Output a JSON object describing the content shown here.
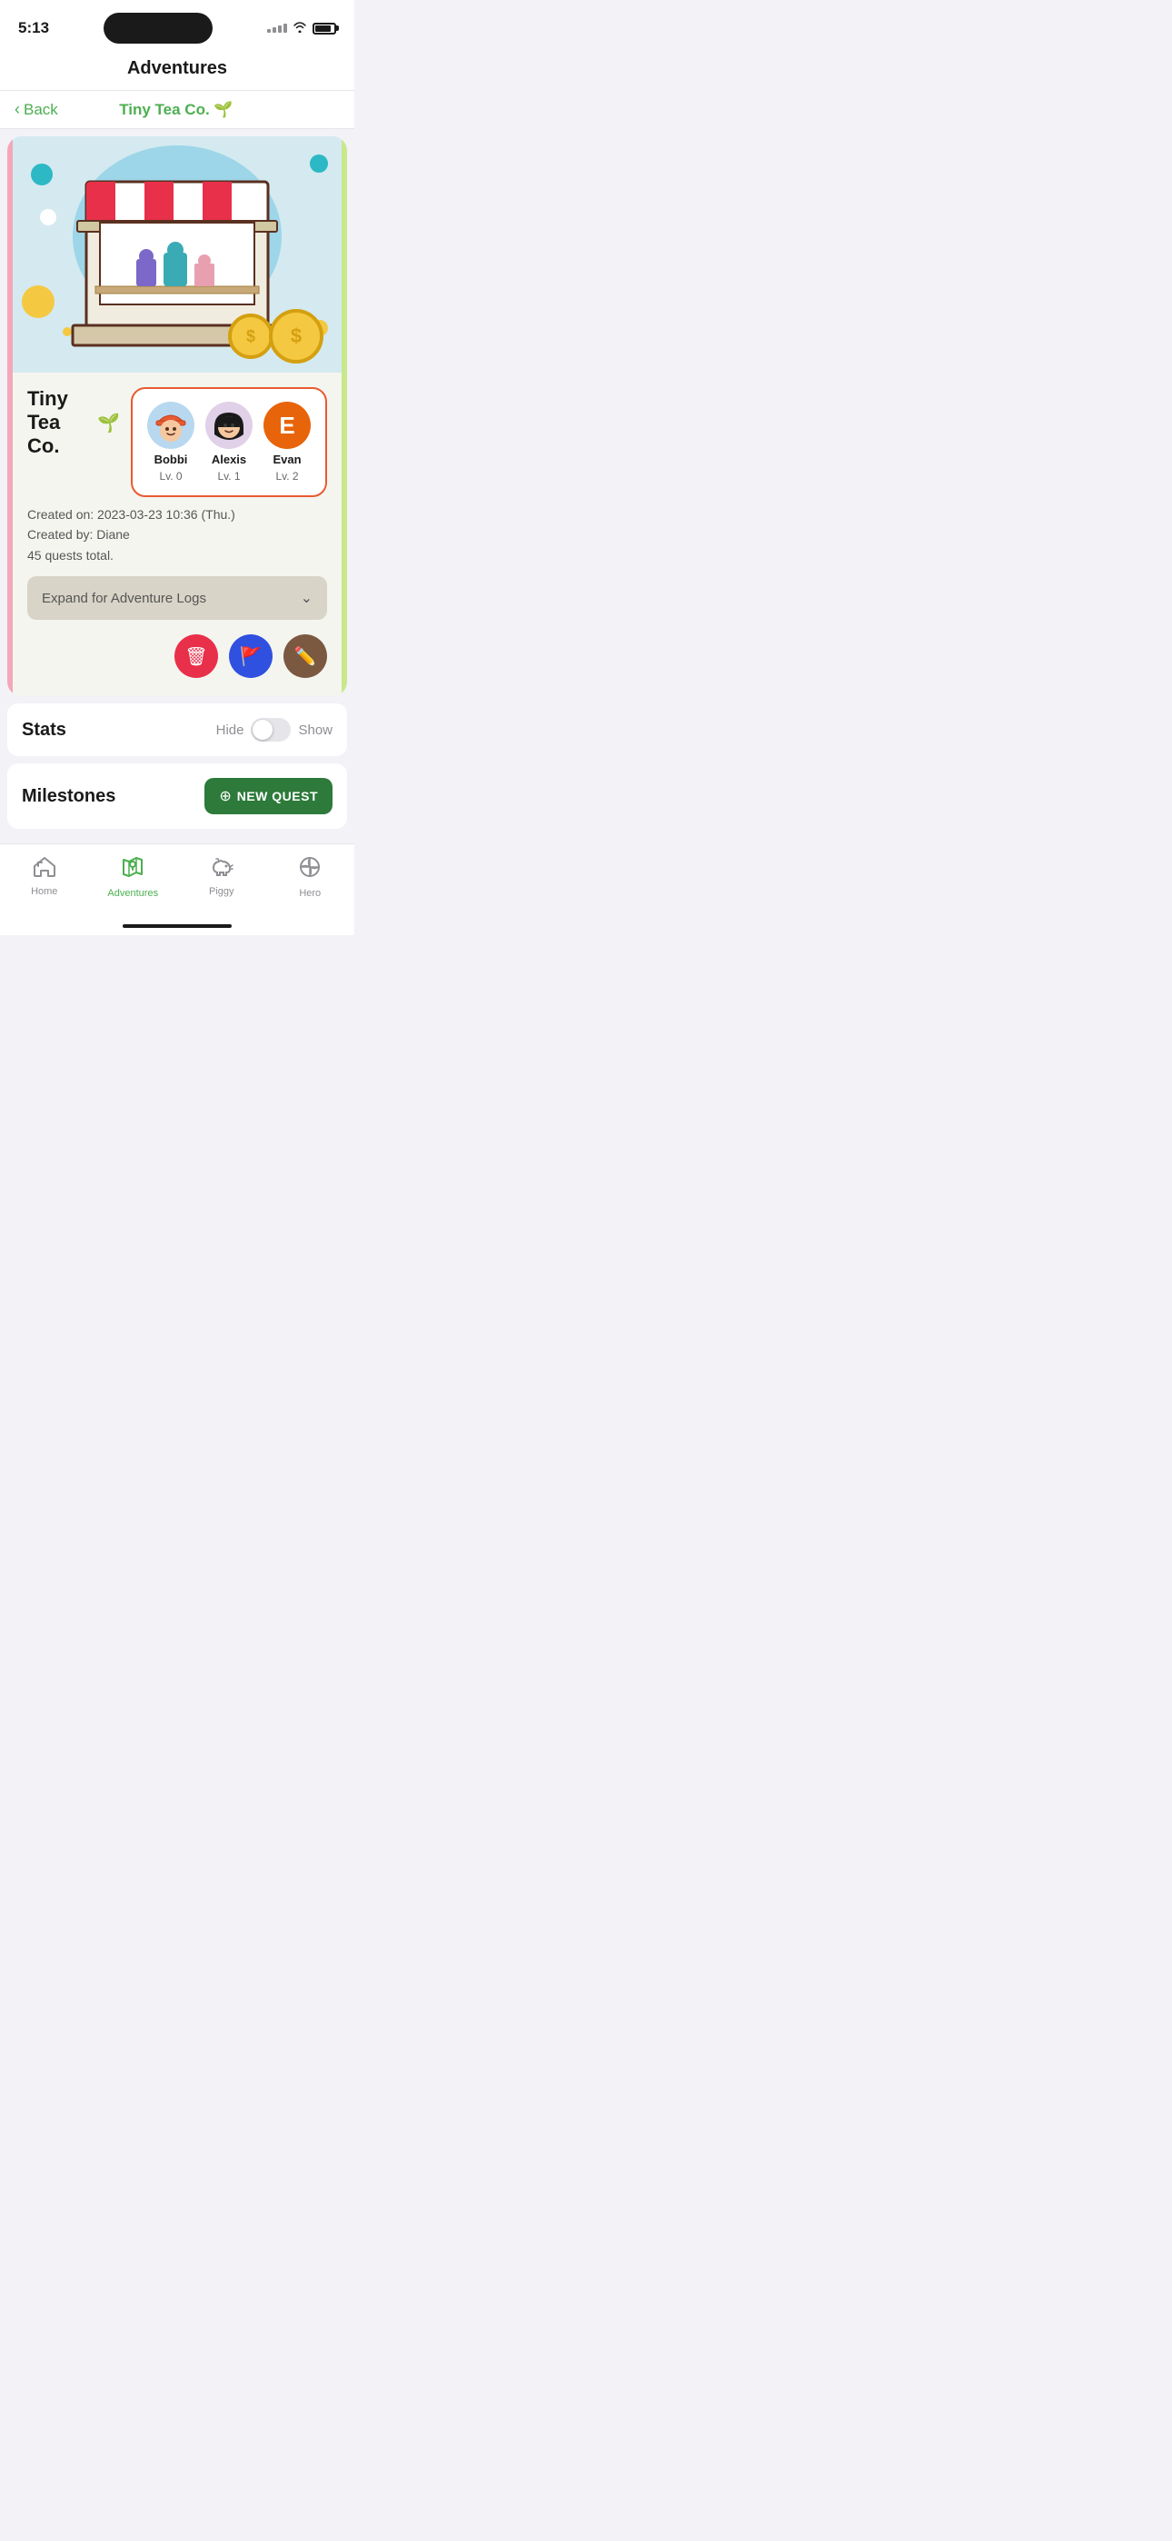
{
  "status_bar": {
    "time": "5:13"
  },
  "header": {
    "title": "Adventures"
  },
  "nav": {
    "back_label": "Back",
    "title": "Tiny Tea Co. 🌱"
  },
  "adventure_card": {
    "title": "Tiny Tea Co.",
    "title_icon": "🌱",
    "players": [
      {
        "name": "Bobbi",
        "level": "Lv. 0",
        "type": "avatar_bobbi"
      },
      {
        "name": "Alexis",
        "level": "Lv. 1",
        "type": "avatar_alexis"
      },
      {
        "name": "Evan",
        "level": "Lv. 2",
        "type": "avatar_evan",
        "initial": "E"
      }
    ],
    "created_on": "Created on: 2023-03-23 10:36 (Thu.)",
    "created_by": "Created by: Diane",
    "quests_total": "45 quests total.",
    "expand_label": "Expand for Adventure Logs"
  },
  "stats": {
    "title": "Stats",
    "hide_label": "Hide",
    "show_label": "Show"
  },
  "milestones": {
    "title": "Milestones",
    "new_quest_label": "NEW QUEST"
  },
  "tabs": [
    {
      "label": "Home",
      "icon": "🏰",
      "active": false
    },
    {
      "label": "Adventures",
      "icon": "🗺️",
      "active": true
    },
    {
      "label": "Piggy",
      "icon": "🐷",
      "active": false
    },
    {
      "label": "Hero",
      "icon": "🌐",
      "active": false
    }
  ],
  "buttons": {
    "delete_icon": "🗑",
    "flag_icon": "🚩",
    "edit_icon": "✏️"
  }
}
